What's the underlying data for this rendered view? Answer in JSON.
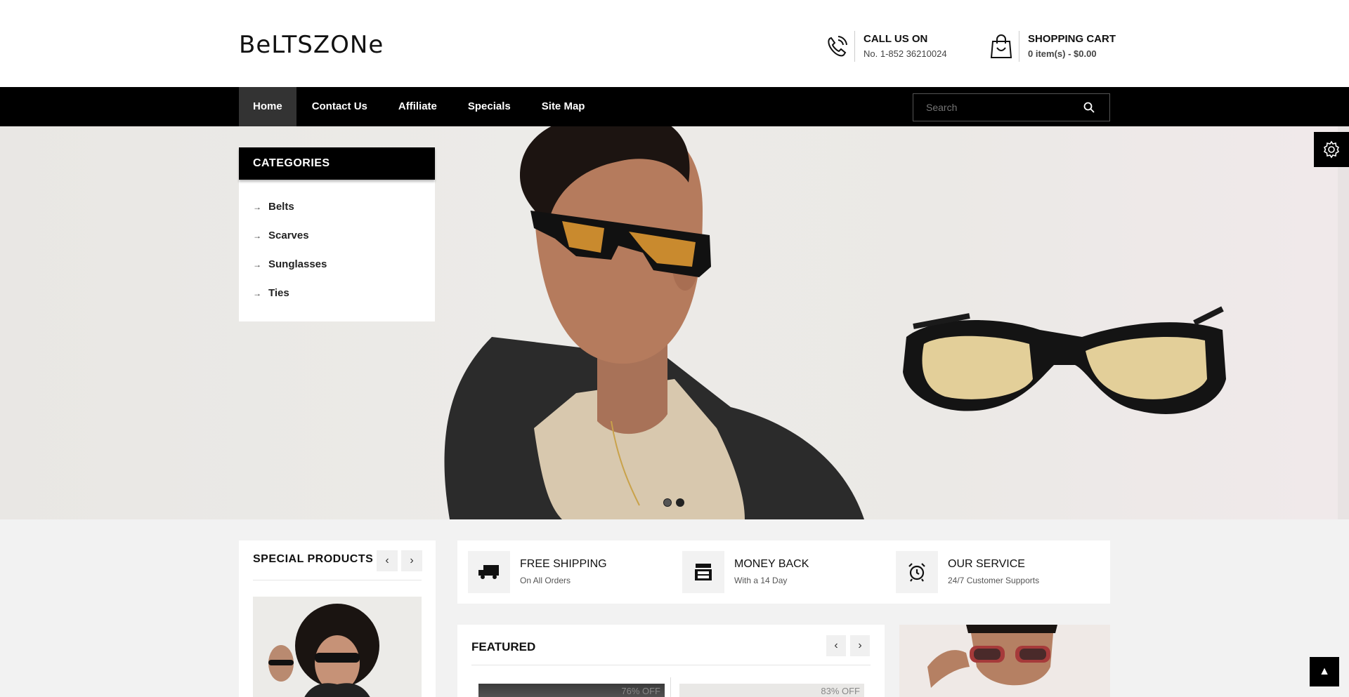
{
  "header": {
    "logo": "BeLTSZONe",
    "call_title": "CALL US ON",
    "call_number": "No. 1-852 36210024",
    "cart_title": "SHOPPING CART",
    "cart_summary": "0 item(s) - $0.00"
  },
  "nav": {
    "items": [
      {
        "label": "Home",
        "active": true
      },
      {
        "label": "Contact Us"
      },
      {
        "label": "Affiliate"
      },
      {
        "label": "Specials"
      },
      {
        "label": "Site Map"
      }
    ],
    "search_placeholder": "Search"
  },
  "categories": {
    "title": "CATEGORIES",
    "items": [
      "Belts",
      "Scarves",
      "Sunglasses",
      "Ties"
    ]
  },
  "hero": {
    "slides_total": 2,
    "active_slide": 1
  },
  "special": {
    "title": "SPECIAL PRODUCTS"
  },
  "services": [
    {
      "title": "FREE SHIPPING",
      "subtitle": "On All Orders",
      "icon": "truck-icon"
    },
    {
      "title": "MONEY BACK",
      "subtitle": "With a 14 Day",
      "icon": "cash-register-icon"
    },
    {
      "title": "OUR SERVICE",
      "subtitle": "24/7 Customer Supports",
      "icon": "alarm-clock-icon"
    }
  ],
  "featured": {
    "title": "FEATURED",
    "products": [
      {
        "discount": "76% OFF"
      },
      {
        "discount": "83% OFF"
      }
    ]
  },
  "icons": {
    "phone": "phone-icon",
    "cart": "shopping-bag-icon",
    "search": "search-icon",
    "settings": "gear-icon",
    "to_top": "arrow-up-icon"
  }
}
